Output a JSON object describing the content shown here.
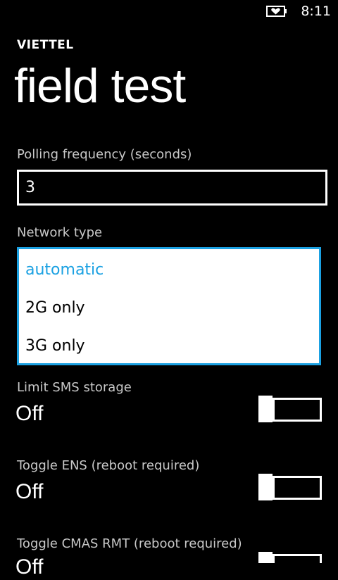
{
  "status_bar": {
    "time": "8:11",
    "battery_icon": "battery-heart-icon"
  },
  "carrier": "VIETTEL",
  "title": "field test",
  "polling": {
    "label": "Polling frequency (seconds)",
    "value": "3"
  },
  "network_type": {
    "label": "Network type",
    "options": [
      "automatic",
      "2G only",
      "3G only"
    ],
    "selected": "automatic"
  },
  "toggles": [
    {
      "label": "Limit SMS storage",
      "value": "Off"
    },
    {
      "label": "Toggle ENS (reboot required)",
      "value": "Off"
    },
    {
      "label": "Toggle CMAS RMT (reboot required)",
      "value": "Off"
    }
  ],
  "colors": {
    "accent": "#1ba1e2",
    "background": "#000000",
    "foreground": "#ffffff"
  }
}
